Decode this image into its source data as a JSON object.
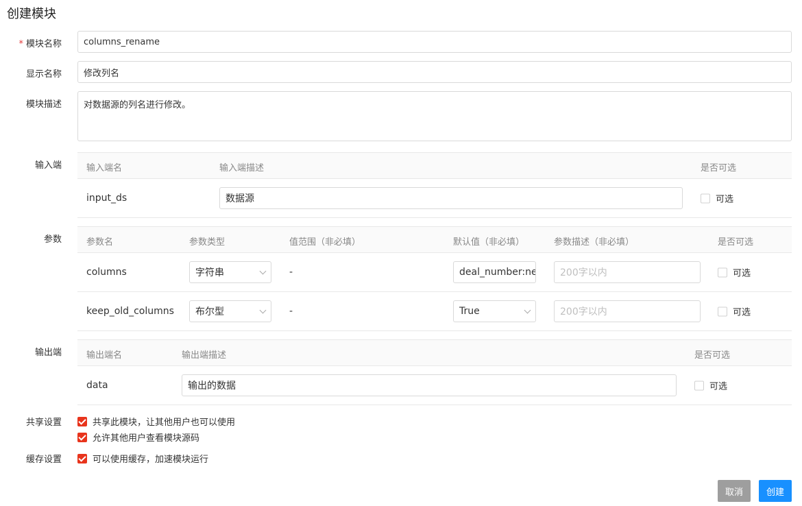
{
  "page_title": "创建模块",
  "fields": {
    "module_name": {
      "label": "模块名称",
      "value": "columns_rename"
    },
    "display_name": {
      "label": "显示名称",
      "value": "修改列名"
    },
    "description": {
      "label": "模块描述",
      "value": "对数据源的列名进行修改。"
    }
  },
  "inputs": {
    "label": "输入端",
    "headers": [
      "输入端名",
      "输入端描述",
      "是否可选"
    ],
    "rows": [
      {
        "name": "input_ds",
        "desc": "数据源",
        "optional_label": "可选"
      }
    ]
  },
  "params": {
    "label": "参数",
    "headers": [
      "参数名",
      "参数类型",
      "值范围（非必填）",
      "默认值（非必填）",
      "参数描述（非必填）",
      "是否可选"
    ],
    "rows": [
      {
        "name": "columns",
        "type": "字符串",
        "range": "-",
        "default": "deal_number:nev",
        "desc_placeholder": "200字以内",
        "optional_label": "可选"
      },
      {
        "name": "keep_old_columns",
        "type": "布尔型",
        "range": "-",
        "default": "True",
        "desc_placeholder": "200字以内",
        "optional_label": "可选"
      }
    ]
  },
  "outputs": {
    "label": "输出端",
    "headers": [
      "输出端名",
      "输出端描述",
      "是否可选"
    ],
    "rows": [
      {
        "name": "data",
        "desc": "输出的数据",
        "optional_label": "可选"
      }
    ]
  },
  "share": {
    "label": "共享设置",
    "options": [
      "共享此模块，让其他用户也可以使用",
      "允许其他用户查看模块源码"
    ]
  },
  "cache": {
    "label": "缓存设置",
    "options": [
      "可以使用缓存，加速模块运行"
    ]
  },
  "buttons": {
    "cancel": "取消",
    "create": "创建"
  },
  "colors": {
    "accent": "#1890ff",
    "checkbox": "#e8341c",
    "cancel": "#9e9e9e"
  }
}
